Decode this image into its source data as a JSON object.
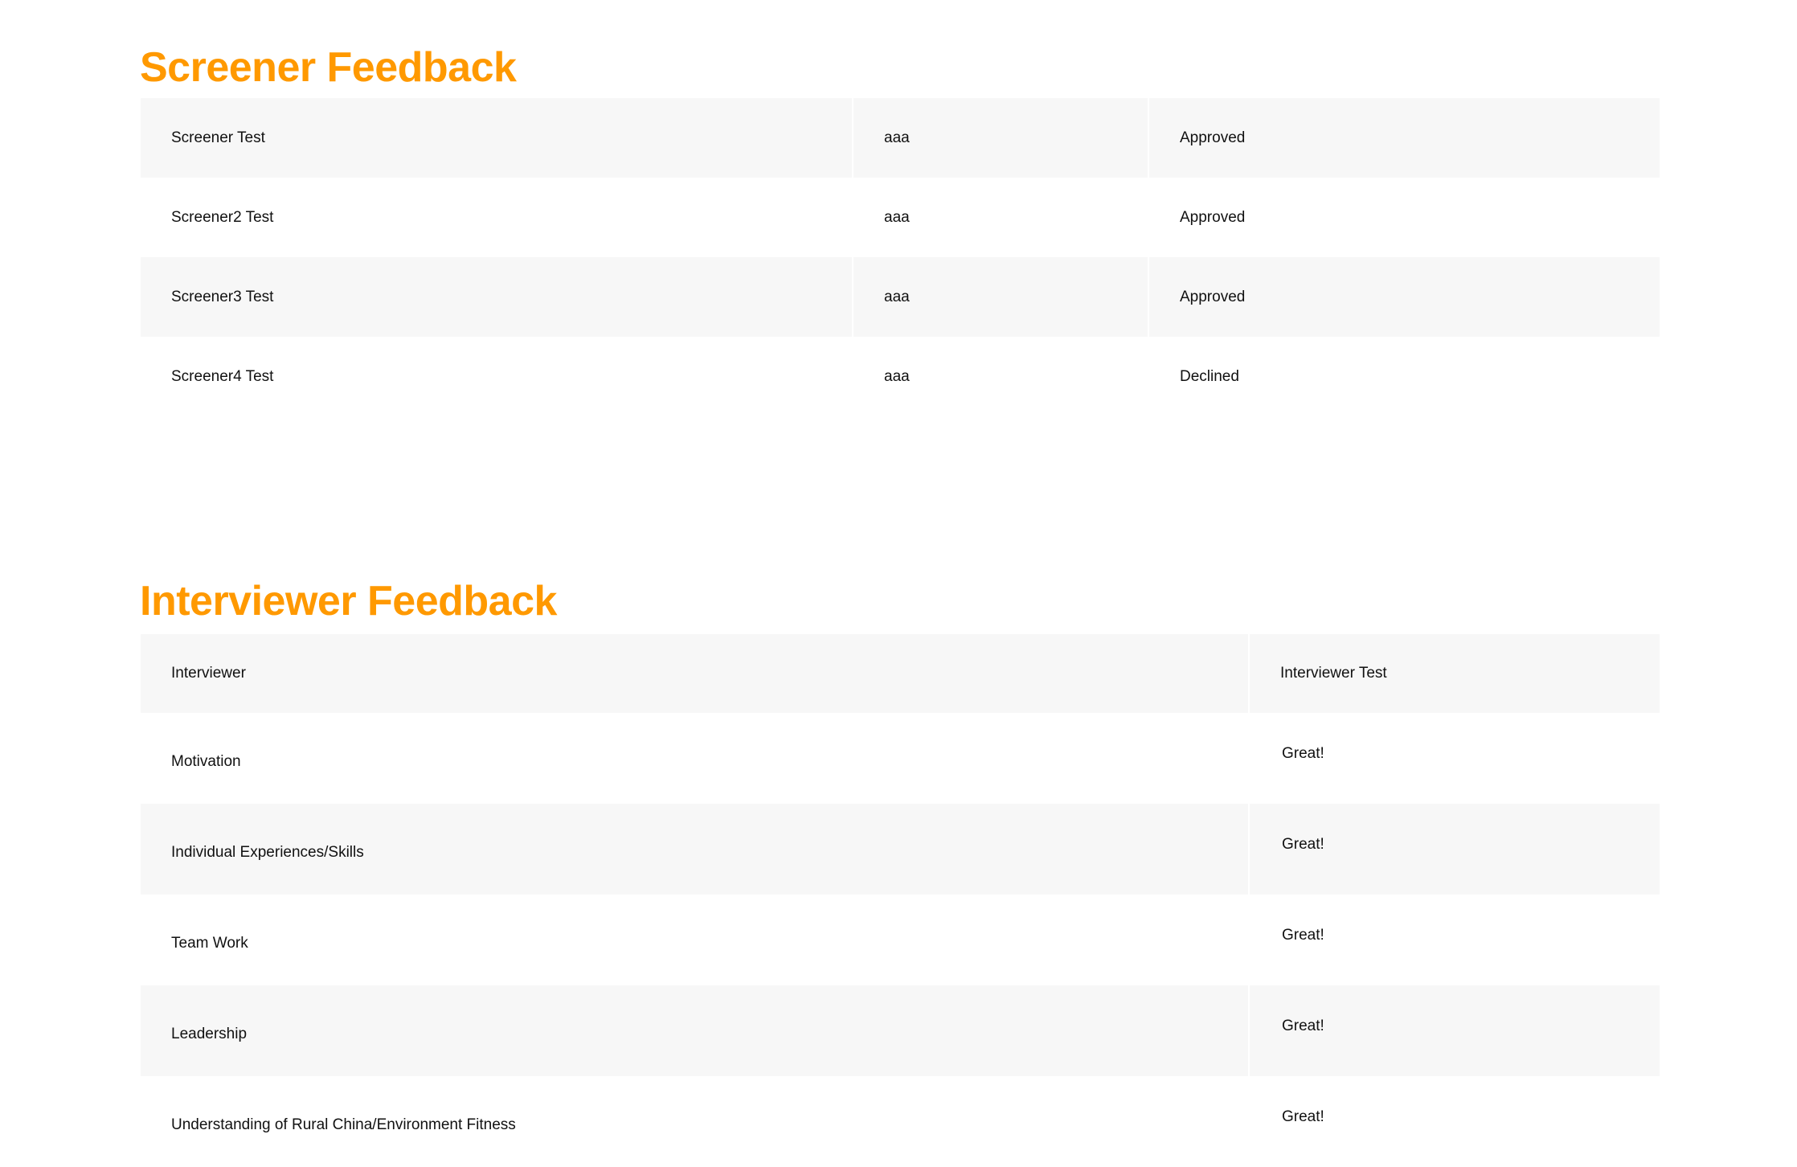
{
  "theme": {
    "accent": "#ff9900",
    "stripe": "#f7f7f7"
  },
  "screener": {
    "title": "Screener Feedback",
    "rows": [
      {
        "name": "Screener Test",
        "comment": "aaa",
        "status": "Approved"
      },
      {
        "name": "Screener2 Test",
        "comment": "aaa",
        "status": "Approved"
      },
      {
        "name": "Screener3 Test",
        "comment": "aaa",
        "status": "Approved"
      },
      {
        "name": "Screener4 Test",
        "comment": "aaa",
        "status": "Declined"
      }
    ]
  },
  "interviewer": {
    "title": "Interviewer Feedback",
    "header": {
      "label": "Interviewer",
      "value": "Interviewer Test"
    },
    "rows": [
      {
        "label": "Motivation",
        "value": "Great!"
      },
      {
        "label": "Individual Experiences/Skills",
        "value": "Great!"
      },
      {
        "label": "Team Work",
        "value": "Great!"
      },
      {
        "label": "Leadership",
        "value": "Great!"
      },
      {
        "label": "Understanding of Rural China/Environment Fitness",
        "value": "Great!"
      }
    ]
  }
}
